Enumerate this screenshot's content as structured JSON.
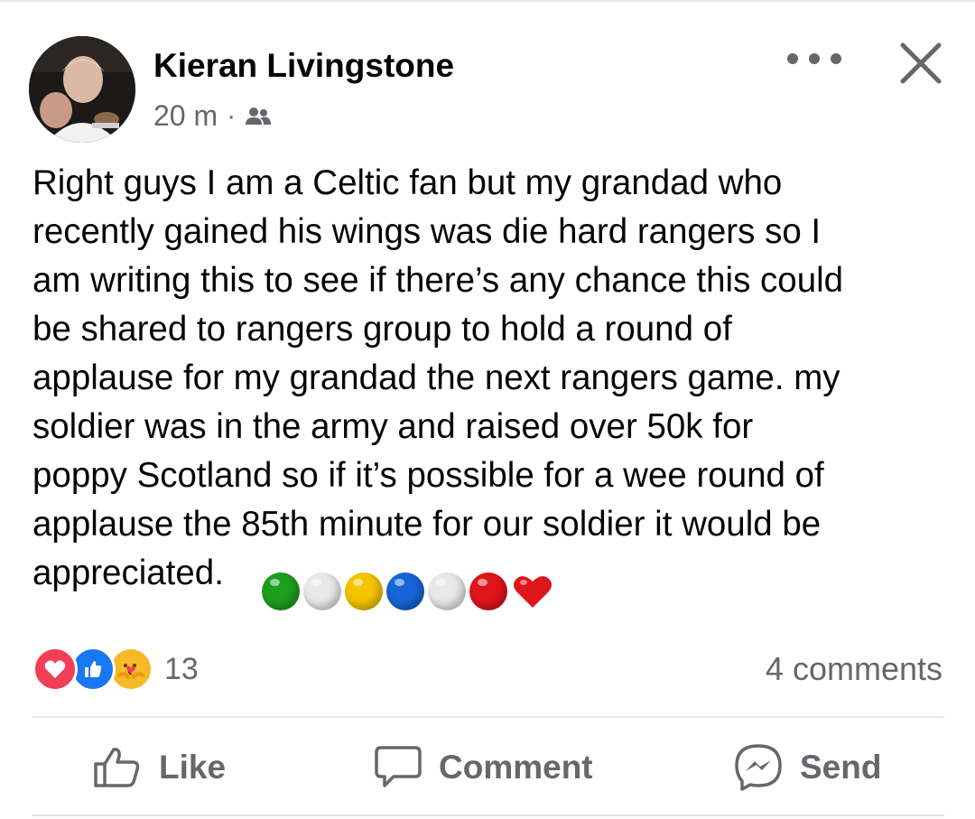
{
  "post": {
    "author": "Kieran Livingstone",
    "time": "20 m",
    "separator": "·",
    "audience_icon": "friends-icon",
    "text": "Right guys I am a Celtic fan but my grandad who\nrecently gained his wings was die hard rangers so I\nam writing this to see if there’s any chance this could\nbe shared to rangers group to hold a round of\napplause for my grandad the next rangers game. my\nsoldier was in the army and raised over 50k for\npoppy Scotland so if it’s possible for a wee round of\napplause the 85th minute for our soldier it would be\nappreciated.",
    "emojis": [
      {
        "name": "green-circle",
        "color": "#1e9e1e"
      },
      {
        "name": "white-circle",
        "color": "#e9e9e9"
      },
      {
        "name": "yellow-circle",
        "color": "#f5c400"
      },
      {
        "name": "blue-circle",
        "color": "#1565d8"
      },
      {
        "name": "white-circle",
        "color": "#e9e9e9"
      },
      {
        "name": "red-circle",
        "color": "#e0151b"
      },
      {
        "name": "red-heart",
        "color": "#e0151b"
      }
    ]
  },
  "reactions": {
    "types": [
      "love-icon",
      "like-icon",
      "care-icon"
    ],
    "count": "13",
    "comments": "4 comments"
  },
  "actions": {
    "like": "Like",
    "comment": "Comment",
    "send": "Send"
  },
  "colors": {
    "secondary_text": "#65676b",
    "like_blue": "#1877f2",
    "love_red": "#f33e58",
    "care_yellow": "#f7b928"
  }
}
